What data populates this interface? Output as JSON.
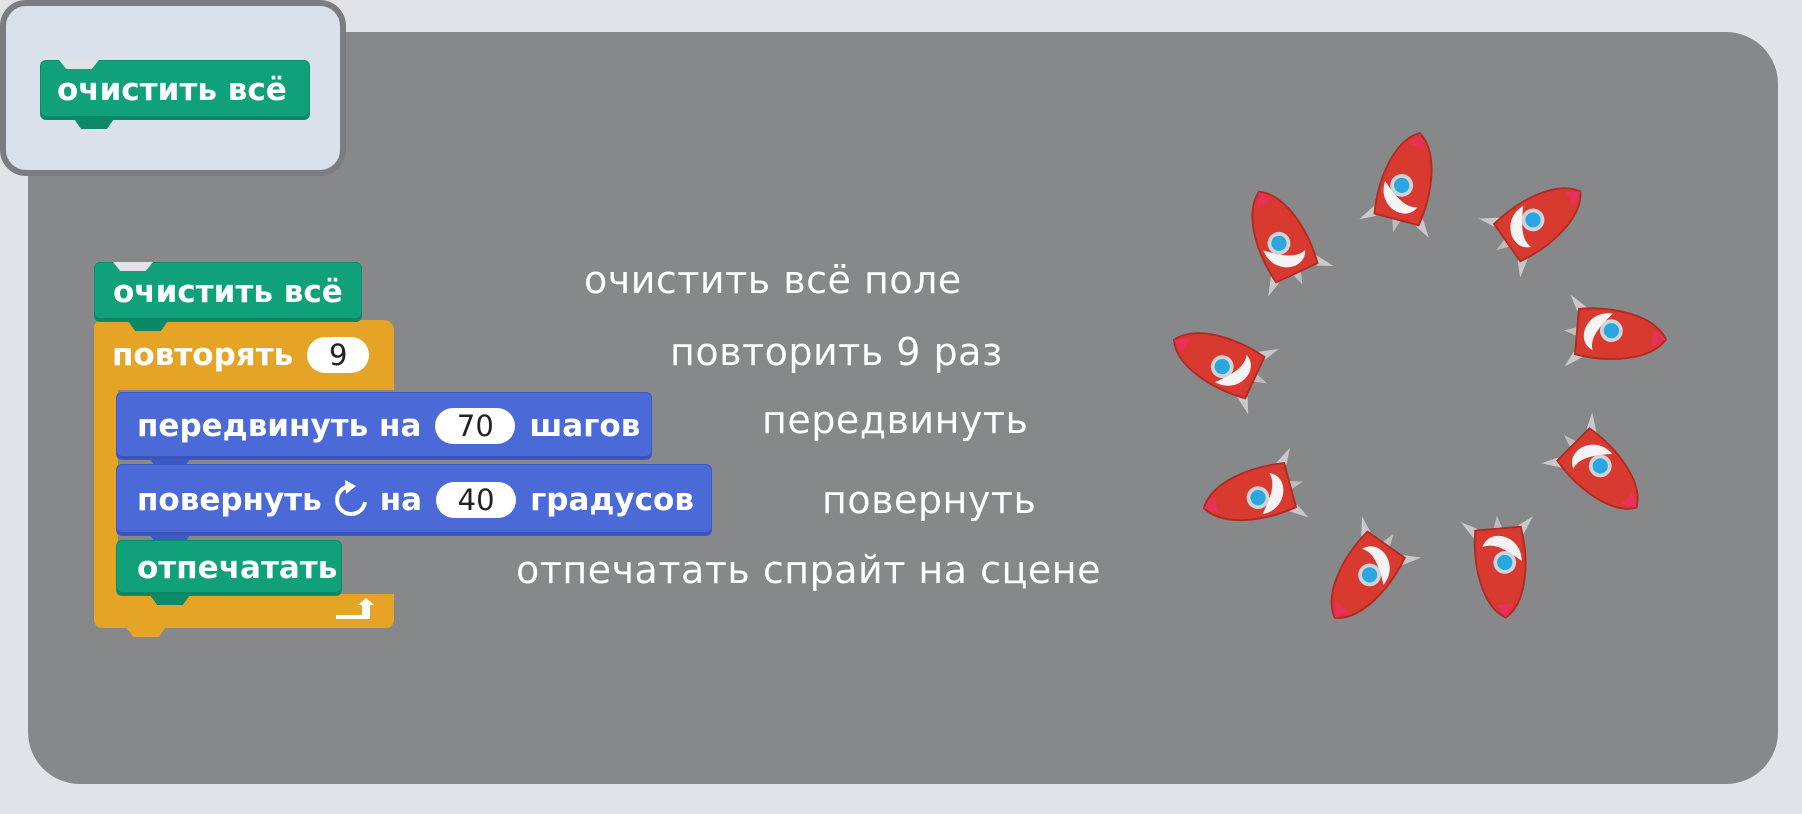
{
  "badge": {
    "block_label": "очистить всё"
  },
  "script": {
    "clear_label": "очистить всё",
    "repeat_label": "повторять",
    "repeat_count": "9",
    "move_label": "передвинуть на",
    "move_steps": "70",
    "move_units": "шагов",
    "turn_label": "повернуть",
    "turn_on": "на",
    "turn_degrees": "40",
    "turn_units": "градусов",
    "stamp_label": "отпечатать"
  },
  "annotations": {
    "clear": "очистить всё поле",
    "repeat": "повторить 9 раз",
    "move": "передвинуть",
    "turn": "повернуть",
    "stamp": "отпечатать спрайт на сцене"
  },
  "stage": {
    "sprite_icon": "rocket-icon",
    "sprite_count": 9
  },
  "colors": {
    "looks_green": "#10a07a",
    "motion_blue": "#4b6ad8",
    "control_orange": "#e6a426",
    "canvas_grey": "#86888a",
    "rocket_red": "#d93a30",
    "rocket_window": "#2aa6e0"
  }
}
